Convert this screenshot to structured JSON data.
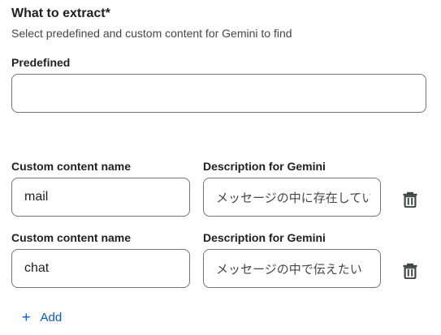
{
  "section": {
    "title": "What to extract*",
    "subtitle": "Select predefined and custom content for Gemini to find"
  },
  "predefined": {
    "label": "Predefined",
    "value": ""
  },
  "custom_rows": [
    {
      "name_label": "Custom content name",
      "name_value": "mail",
      "description_label": "Description for Gemini",
      "description_value": "メッセージの中に存在してい"
    },
    {
      "name_label": "Custom content name",
      "name_value": "chat",
      "description_label": "Description for Gemini",
      "description_value": "メッセージの中で伝えたい"
    }
  ],
  "add_button": {
    "icon": "+",
    "label": "Add"
  },
  "colors": {
    "accent": "#0b57d0",
    "border": "#747775",
    "icon": "#444746"
  }
}
